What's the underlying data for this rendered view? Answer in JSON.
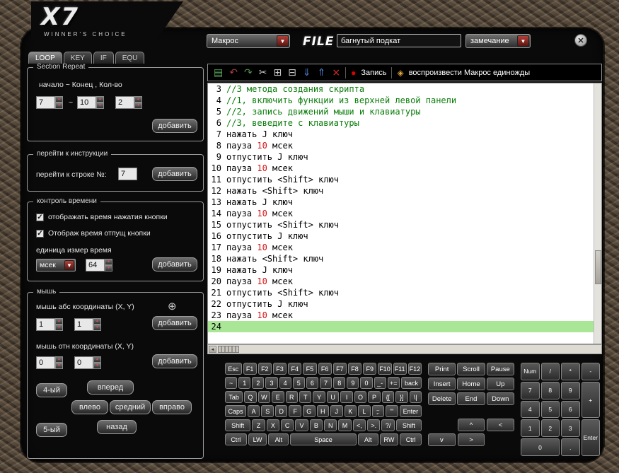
{
  "window": {
    "logo": "X7",
    "logo_sub": "WINNER'S CHOICE",
    "close": "✕"
  },
  "header": {
    "macro_dropdown": "Макрос",
    "dropdown_arrow": "▼",
    "file_label": "FILE",
    "filename": "багнутый подкат",
    "note_dropdown": "замечание"
  },
  "tabs": [
    {
      "label": "LOOP",
      "active": true
    },
    {
      "label": "KEY",
      "active": false
    },
    {
      "label": "IF",
      "active": false
    },
    {
      "label": "EQU",
      "active": false
    }
  ],
  "panel": {
    "section_repeat": {
      "title": "Section Repeat",
      "labels": "начало ~ Конец , Кол-во",
      "start": "7",
      "tilde": "~",
      "end": "10",
      "count": "2",
      "add": "добавить"
    },
    "goto": {
      "title": "перейти к инструкции",
      "label": "перейти к строке №:",
      "line": "7",
      "add": "добавить"
    },
    "time": {
      "title": "контроль времени",
      "cb1": "отображать время нажатия кнопки",
      "cb2": "Отображ время отпущ кнопки",
      "check": "✓",
      "unit_label": "единица измер  время",
      "unit": "мсек",
      "value": "64",
      "add": "добавить"
    },
    "mouse": {
      "title": "мышь",
      "abs_label": "мышь абс координаты (X, Y)",
      "crosshair": "⊕",
      "abs_x": "1",
      "abs_y": "1",
      "add1": "добавить",
      "rel_label": "мышь отн координаты (X, Y)",
      "rel_x": "0",
      "rel_y": "0",
      "add2": "добавить",
      "btn4": "4-ый",
      "btn5": "5-ый",
      "fwd": "вперед",
      "left": "влево",
      "mid": "средний",
      "right": "вправо",
      "back": "назад"
    }
  },
  "toolbar": {
    "icons": [
      {
        "name": "save-icon",
        "glyph": "▤",
        "color": "#5da85d"
      },
      {
        "name": "undo-icon",
        "glyph": "↶",
        "color": "#a04040"
      },
      {
        "name": "redo-icon",
        "glyph": "↷",
        "color": "#50904e"
      },
      {
        "name": "cut-icon",
        "glyph": "✂",
        "color": "#cccccc"
      },
      {
        "name": "copy-icon",
        "glyph": "⊞",
        "color": "#c8c8c8"
      },
      {
        "name": "paste-icon",
        "glyph": "⊟",
        "color": "#c8c8c8"
      },
      {
        "name": "import-icon",
        "glyph": "⇓",
        "color": "#4d7fd0"
      },
      {
        "name": "export-icon",
        "glyph": "⇑",
        "color": "#4d7fd0"
      },
      {
        "name": "delete-icon",
        "glyph": "×",
        "color": "#e03024"
      }
    ],
    "record_icon": "●",
    "record_color": "#e00000",
    "record_label": "Запись",
    "play_icon": "◈",
    "play_color": "#e0a23c",
    "play_label": "воспроизвести Макрос единожды"
  },
  "editor": {
    "active_line": 24,
    "lines": [
      {
        "n": 3,
        "comment": true,
        "t": "//3 метода создания скрипта"
      },
      {
        "n": 4,
        "comment": true,
        "t": "//1, включить функции из верхней левой панели"
      },
      {
        "n": 5,
        "comment": true,
        "t": "//2, запись движений мыши и клавиатуры"
      },
      {
        "n": 6,
        "comment": true,
        "t": "//3, веведите с клавиатуры"
      },
      {
        "n": 7,
        "comment": false,
        "t": "нажать J ключ"
      },
      {
        "n": 8,
        "comment": false,
        "t": "пауза 10 мсек"
      },
      {
        "n": 9,
        "comment": false,
        "t": "отпустить J ключ"
      },
      {
        "n": 10,
        "comment": false,
        "t": "пауза 10 мсек"
      },
      {
        "n": 11,
        "comment": false,
        "t": "отпустить <Shift> ключ"
      },
      {
        "n": 12,
        "comment": false,
        "t": "нажать <Shift> ключ"
      },
      {
        "n": 13,
        "comment": false,
        "t": "нажать J ключ"
      },
      {
        "n": 14,
        "comment": false,
        "t": "пауза 10 мсек"
      },
      {
        "n": 15,
        "comment": false,
        "t": "отпустить <Shift> ключ"
      },
      {
        "n": 16,
        "comment": false,
        "t": "отпустить J ключ"
      },
      {
        "n": 17,
        "comment": false,
        "t": "пауза 10 мсек"
      },
      {
        "n": 18,
        "comment": false,
        "t": "нажать <Shift> ключ"
      },
      {
        "n": 19,
        "comment": false,
        "t": "нажать J ключ"
      },
      {
        "n": 20,
        "comment": false,
        "t": "пауза 10 мсек"
      },
      {
        "n": 21,
        "comment": false,
        "t": "отпустить <Shift> ключ"
      },
      {
        "n": 22,
        "comment": false,
        "t": "отпустить J ключ"
      },
      {
        "n": 23,
        "comment": false,
        "t": "пауза 10 мсек"
      },
      {
        "n": 24,
        "comment": false,
        "t": ""
      }
    ]
  },
  "keyboard": {
    "function_row": [
      "Esc",
      "F1",
      "F2",
      "F3",
      "F4",
      "F5",
      "F6",
      "F7",
      "F8",
      "F9",
      "F10",
      "F11",
      "F12"
    ],
    "main_rows": [
      [
        "~",
        "1",
        "2",
        "3",
        "4",
        "5",
        "6",
        "7",
        "8",
        "9",
        "0",
        "_-",
        "+=",
        "back"
      ],
      [
        "Tab",
        "Q",
        "W",
        "E",
        "R",
        "T",
        "Y",
        "U",
        "I",
        "O",
        "P",
        "{[",
        "}]",
        "\\|"
      ],
      [
        "Caps",
        "A",
        "S",
        "D",
        "F",
        "G",
        "H",
        "J",
        "K",
        "L",
        ";:",
        "'\"",
        "Enter"
      ],
      [
        "Shift",
        "Z",
        "X",
        "C",
        "V",
        "B",
        "N",
        "M",
        "<,",
        ">.",
        "?/",
        "Shift"
      ],
      [
        "Ctrl",
        "LW",
        "Alt",
        "Space",
        "Alt",
        "RW",
        "Ctrl"
      ]
    ],
    "nav_rows": [
      [
        "Print",
        "Scroll",
        "Pause"
      ],
      [
        "Insert",
        "Home",
        "Up"
      ],
      [
        "Delete",
        "End",
        "Down"
      ]
    ],
    "arrow_up": "^",
    "arrow_row": [
      "<",
      "v",
      ">"
    ],
    "numpad": [
      "Num",
      "/",
      "*",
      "-",
      "7",
      "8",
      "9",
      "+",
      "4",
      "5",
      "6",
      "1",
      "2",
      "3",
      "Enter",
      "0",
      "."
    ]
  }
}
